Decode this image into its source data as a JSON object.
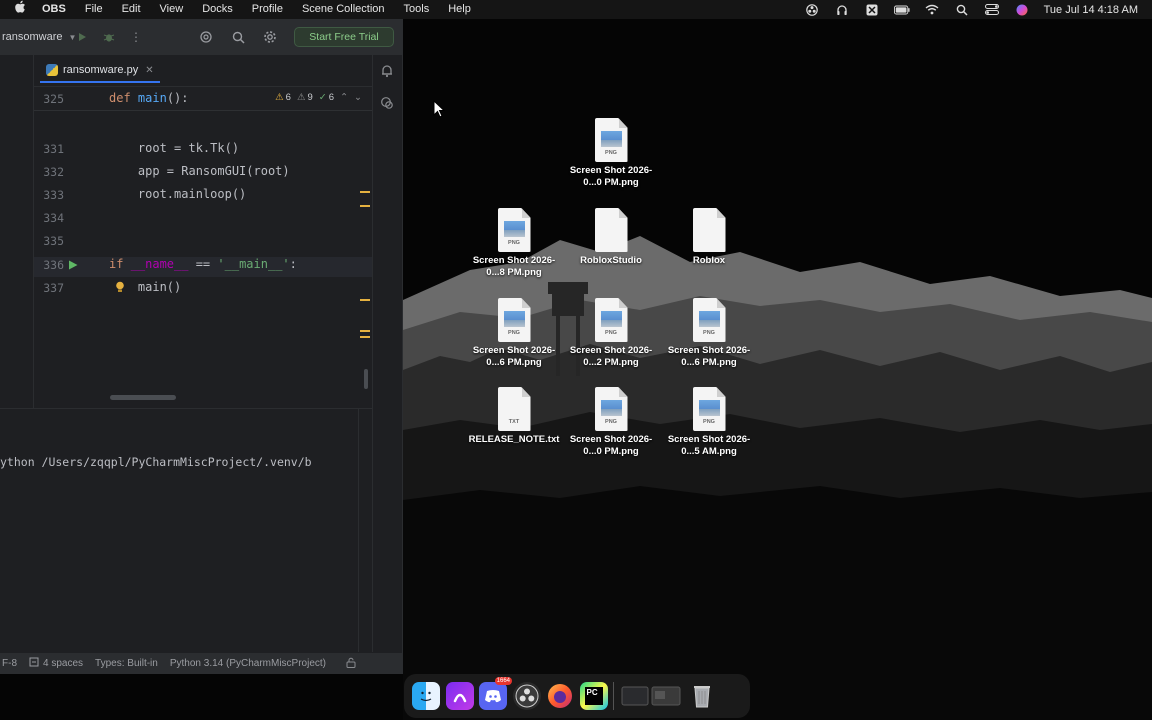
{
  "menubar": {
    "app_name": "OBS",
    "items": [
      "File",
      "Edit",
      "View",
      "Docks",
      "Profile",
      "Scene Collection",
      "Tools",
      "Help"
    ],
    "clock": "Tue Jul 14  4:18 AM"
  },
  "ide": {
    "project_name": "ransomware",
    "trial_button": "Start Free Trial",
    "tab_label": "ransomware.py",
    "inspections": {
      "warnings": "6",
      "weak_warnings": "9",
      "ok": "6"
    },
    "sticky_line": {
      "number": "325",
      "code_def": "def",
      "code_name": "main",
      "code_rest": "():"
    },
    "lines": [
      {
        "number": "331",
        "code": "    root = tk.Tk()"
      },
      {
        "number": "332",
        "code": "    app = RansomGUI(root)"
      },
      {
        "number": "333",
        "code": "    root.mainloop()"
      },
      {
        "number": "334",
        "code": ""
      },
      {
        "number": "335",
        "code": ""
      },
      {
        "number": "336",
        "kw": "if",
        "dunder": "__name__",
        "op": " == ",
        "str": "'__main__'",
        "colon": ":"
      },
      {
        "number": "337",
        "code": "    main()"
      }
    ],
    "run_output": "ython /Users/zqqpl/PyCharmMiscProject/.venv/b",
    "status": {
      "encoding": "F-8",
      "indent": "4 spaces",
      "types": "Types: Built-in",
      "interpreter": "Python 3.14 (PyCharmMiscProject)"
    }
  },
  "desktop": {
    "icons": [
      {
        "label": "Screen Shot 2026-0...0 PM.png",
        "type": "png"
      },
      {
        "label": "Screen Shot 2026-0...8 PM.png",
        "type": "png"
      },
      {
        "label": "RobloxStudio",
        "type": "blank"
      },
      {
        "label": "Roblox",
        "type": "blank"
      },
      {
        "label": "Screen Shot 2026-0...6 PM.png",
        "type": "png"
      },
      {
        "label": "Screen Shot 2026-0...2 PM.png",
        "type": "png"
      },
      {
        "label": "Screen Shot 2026-0...6 PM.png",
        "type": "png"
      },
      {
        "label": "RELEASE_NOTE.txt",
        "type": "txt"
      },
      {
        "label": "Screen Shot 2026-0...0 PM.png",
        "type": "png"
      },
      {
        "label": "Screen Shot 2026-0...5 AM.png",
        "type": "png"
      }
    ],
    "ext_png": "PNG",
    "ext_txt": "TXT"
  },
  "dock": {
    "discord_badge": "1664",
    "pycharm_label": "PC",
    "apps": [
      "finder-icon",
      "arc-icon",
      "discord-icon",
      "obs-icon",
      "firefox-icon",
      "pycharm-icon",
      "window-thumbnail-icon",
      "trash-icon"
    ]
  },
  "colors": {
    "ide_bg": "#1e1f22",
    "keyword": "#cf8e6d",
    "function": "#56a8f5",
    "string": "#6aab73",
    "accent": "#3574f0"
  }
}
